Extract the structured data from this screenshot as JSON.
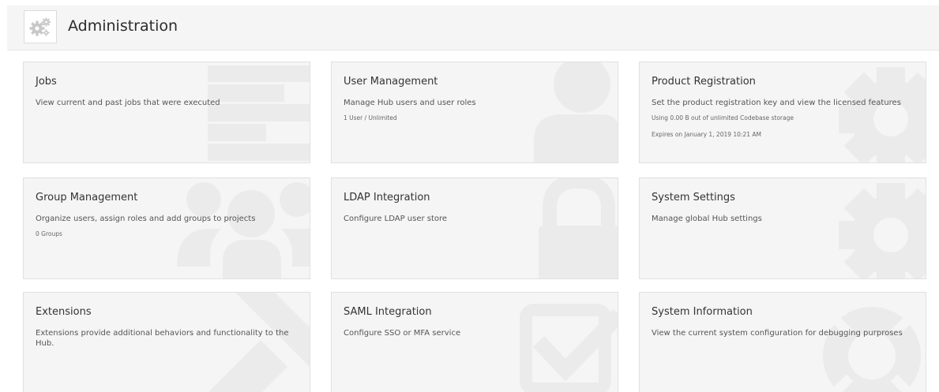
{
  "header": {
    "title": "Administration",
    "icon": "gears-icon"
  },
  "cards": {
    "jobs": {
      "title": "Jobs",
      "description": "View current and past jobs that were executed",
      "icon": "list-icon"
    },
    "user_management": {
      "title": "User Management",
      "description": "Manage Hub users and user roles",
      "meta": "1 User / Unlimited",
      "icon": "user-icon"
    },
    "product_registration": {
      "title": "Product Registration",
      "description": "Set the product registration key and view the licensed features",
      "meta_storage": "Using 0.00 B out of unlimited Codebase storage",
      "meta_expiry": "Expires on January 1, 2019 10:21 AM",
      "icon": "gear-icon"
    },
    "group_management": {
      "title": "Group Management",
      "description": "Organize users, assign roles and add groups to projects",
      "meta": "0 Groups",
      "icon": "users-icon"
    },
    "ldap_integration": {
      "title": "LDAP Integration",
      "description": "Configure LDAP user store",
      "icon": "lock-icon"
    },
    "system_settings": {
      "title": "System Settings",
      "description": "Manage global Hub settings",
      "icon": "gear-icon"
    },
    "extensions": {
      "title": "Extensions",
      "description": "Extensions provide additional behaviors and functionality to the Hub.",
      "icon": "wrench-icon"
    },
    "saml_integration": {
      "title": "SAML Integration",
      "description": "Configure SSO or MFA service",
      "icon": "checkbox-icon"
    },
    "system_information": {
      "title": "System Information",
      "description": "View the current system configuration for debugging purproses",
      "icon": "lifebuoy-icon"
    }
  },
  "colors": {
    "page_background": "#ffffff",
    "card_background": "#f5f5f5",
    "card_border": "#e0e0e0",
    "watermark": "#ebebeb",
    "header_icon": "#c8c8c8"
  }
}
